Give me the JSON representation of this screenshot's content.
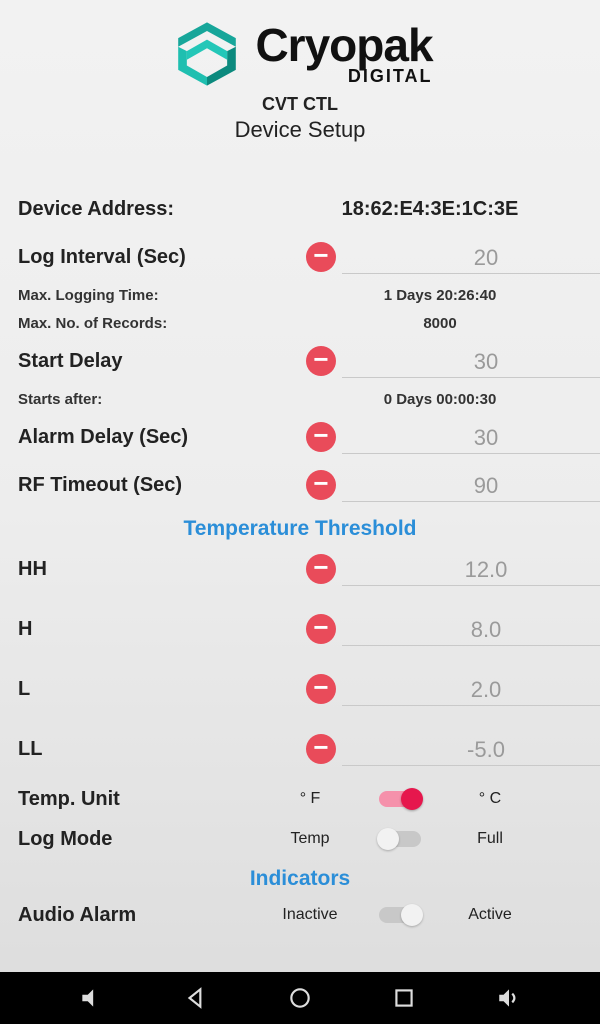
{
  "brand": {
    "name": "Cryopak",
    "sub": "DIGITAL"
  },
  "titles": {
    "line1": "CVT CTL",
    "line2": "Device Setup"
  },
  "address": {
    "label": "Device Address:",
    "value": "18:62:E4:3E:1C:3E"
  },
  "logInterval": {
    "label": "Log Interval (Sec)",
    "value": "20"
  },
  "maxLogTime": {
    "label": "Max. Logging Time:",
    "value": "1 Days 20:26:40"
  },
  "maxRecords": {
    "label": "Max. No. of Records:",
    "value": "8000"
  },
  "startDelay": {
    "label": "Start Delay",
    "value": "30"
  },
  "startsAfter": {
    "label": "Starts after:",
    "value": "0 Days 00:00:30"
  },
  "alarmDelay": {
    "label": "Alarm Delay (Sec)",
    "value": "30"
  },
  "rfTimeout": {
    "label": "RF Timeout (Sec)",
    "value": "90"
  },
  "tempSection": "Temperature Threshold",
  "thresholds": {
    "hh": {
      "label": "HH",
      "value": "12.0"
    },
    "h": {
      "label": "H",
      "value": "8.0"
    },
    "l": {
      "label": "L",
      "value": "2.0"
    },
    "ll": {
      "label": "LL",
      "value": "-5.0"
    }
  },
  "tempUnit": {
    "label": "Temp. Unit",
    "left": "° F",
    "right": "° C"
  },
  "logMode": {
    "label": "Log Mode",
    "left": "Temp",
    "right": "Full"
  },
  "indicatorsSection": "Indicators",
  "audioAlarm": {
    "label": "Audio Alarm",
    "left": "Inactive",
    "right": "Active"
  }
}
